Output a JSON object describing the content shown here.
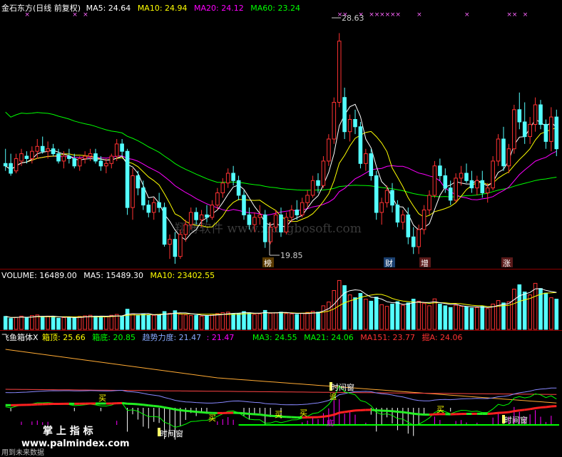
{
  "colors": {
    "bg": "#000000",
    "up": "#ff3232",
    "down": "#54ffff",
    "ma5": "#ffffff",
    "ma10": "#ffff00",
    "ma20": "#ff00ff",
    "ma60": "#00ff00",
    "sep": "#8b0000",
    "label": "#ffffff"
  },
  "header": {
    "title": "金石东方(日线 前复权)",
    "ma5": "MA5: 24.64",
    "ma10": "MA10: 24.94",
    "ma20": "MA20: 24.12",
    "ma60": "MA60: 23.24"
  },
  "price_panel": {
    "high_label": "28.63",
    "low_label": "19.85",
    "markers": [
      "榜",
      "财",
      "增",
      "涨"
    ]
  },
  "volume_panel": {
    "label": "VOLUME: 16489.00",
    "ma5": "MA5: 15489.30",
    "ma10": "MA10: 23402.55"
  },
  "indicator_panel": {
    "name": "飞鱼箱体X",
    "top": "箱顶: 25.66",
    "bottom": "箱底: 20.85",
    "trend": "趋势力度: 21.47",
    "trend2": ": 21.47",
    "ma3": "MA3: 24.55",
    "ma21": "MA21: 24.06",
    "ma151": "MA151: 23.77",
    "jue": "掘A: 24.06",
    "signals": [
      "买",
      "买",
      "买",
      "买",
      "买",
      "时间窗",
      "时间窗",
      "时间窗",
      "追",
      "底"
    ]
  },
  "watermark": {
    "site": "翔博软件 www.xiangbosoft.com",
    "brand": "掌 上 指 标",
    "url": "www.palmindex.com",
    "footer": "用到未来数据"
  },
  "chart_data": {
    "type": "candlestick",
    "title": "金石东方(日线 前复权)",
    "price_range": [
      19.2,
      29.4
    ],
    "annotations": {
      "high": 28.63,
      "low": 19.85
    },
    "ma_last": {
      "MA5": 24.64,
      "MA10": 24.94,
      "MA20": 24.12,
      "MA60": 23.24
    },
    "volume_last": {
      "VOLUME": 16489.0,
      "MA5": 15489.3,
      "MA10": 23402.55
    },
    "candles": [
      [
        23.3,
        23.9,
        23.0,
        23.2
      ],
      [
        23.3,
        23.7,
        22.8,
        22.9
      ],
      [
        23.0,
        23.7,
        22.9,
        23.5
      ],
      [
        23.4,
        23.9,
        23.2,
        23.7
      ],
      [
        23.6,
        23.8,
        23.3,
        23.5
      ],
      [
        23.5,
        24.0,
        23.3,
        23.8
      ],
      [
        23.8,
        24.3,
        23.5,
        24.0
      ],
      [
        24.0,
        24.4,
        23.7,
        23.8
      ],
      [
        23.8,
        24.2,
        23.5,
        23.9
      ],
      [
        23.9,
        24.1,
        23.6,
        23.7
      ],
      [
        23.7,
        23.9,
        23.3,
        23.4
      ],
      [
        23.4,
        23.8,
        23.1,
        23.6
      ],
      [
        23.6,
        23.9,
        23.3,
        23.5
      ],
      [
        23.5,
        23.7,
        23.1,
        23.2
      ],
      [
        23.2,
        23.6,
        23.0,
        23.5
      ],
      [
        23.5,
        23.8,
        23.3,
        23.6
      ],
      [
        23.6,
        23.9,
        23.4,
        23.7
      ],
      [
        23.7,
        23.9,
        23.3,
        23.4
      ],
      [
        23.4,
        23.6,
        23.0,
        23.2
      ],
      [
        23.2,
        23.5,
        22.9,
        23.3
      ],
      [
        23.3,
        23.7,
        23.1,
        23.6
      ],
      [
        23.6,
        24.3,
        23.4,
        24.1
      ],
      [
        24.1,
        24.3,
        23.6,
        23.8
      ],
      [
        23.8,
        23.9,
        21.2,
        21.5
      ],
      [
        21.5,
        23.1,
        21.0,
        22.8
      ],
      [
        22.8,
        23.0,
        22.0,
        22.3
      ],
      [
        22.3,
        22.6,
        21.4,
        21.6
      ],
      [
        21.6,
        21.8,
        21.1,
        21.3
      ],
      [
        21.3,
        21.9,
        21.0,
        21.7
      ],
      [
        21.7,
        22.1,
        21.3,
        21.5
      ],
      [
        21.5,
        21.7,
        19.9,
        20.0
      ],
      [
        20.0,
        20.4,
        19.4,
        20.2
      ],
      [
        20.2,
        20.5,
        19.2,
        19.5
      ],
      [
        19.5,
        20.6,
        19.4,
        20.4
      ],
      [
        20.4,
        21.0,
        20.1,
        20.8
      ],
      [
        20.8,
        21.5,
        20.6,
        21.3
      ],
      [
        21.3,
        21.5,
        20.8,
        21.0
      ],
      [
        21.0,
        21.4,
        20.7,
        21.2
      ],
      [
        21.2,
        21.6,
        20.9,
        21.1
      ],
      [
        21.1,
        21.8,
        21.0,
        21.6
      ],
      [
        21.6,
        22.3,
        21.4,
        22.1
      ],
      [
        22.1,
        22.7,
        21.9,
        22.5
      ],
      [
        22.5,
        23.1,
        22.3,
        22.9
      ],
      [
        22.9,
        23.2,
        22.4,
        22.6
      ],
      [
        22.6,
        22.8,
        21.8,
        22.0
      ],
      [
        22.0,
        22.2,
        21.0,
        21.2
      ],
      [
        21.2,
        21.5,
        20.6,
        20.8
      ],
      [
        20.8,
        21.3,
        20.5,
        21.1
      ],
      [
        21.1,
        21.6,
        20.8,
        21.2
      ],
      [
        21.2,
        21.4,
        19.85,
        20.1
      ],
      [
        20.1,
        20.9,
        20.0,
        20.7
      ],
      [
        20.7,
        21.4,
        20.5,
        21.2
      ],
      [
        21.2,
        21.5,
        20.3,
        20.5
      ],
      [
        20.5,
        21.3,
        20.4,
        21.1
      ],
      [
        21.1,
        21.6,
        20.9,
        21.4
      ],
      [
        21.4,
        21.8,
        21.0,
        21.2
      ],
      [
        21.2,
        21.9,
        21.1,
        21.7
      ],
      [
        21.7,
        22.2,
        21.5,
        22.0
      ],
      [
        22.0,
        22.8,
        21.9,
        22.6
      ],
      [
        22.6,
        22.9,
        22.1,
        22.4
      ],
      [
        22.4,
        23.6,
        22.3,
        23.4
      ],
      [
        23.4,
        24.5,
        23.2,
        24.3
      ],
      [
        24.3,
        26.0,
        24.1,
        25.8
      ],
      [
        25.8,
        28.63,
        25.6,
        28.3
      ],
      [
        26.0,
        26.4,
        24.3,
        24.6
      ],
      [
        24.6,
        25.3,
        24.2,
        25.1
      ],
      [
        25.1,
        25.5,
        24.5,
        24.8
      ],
      [
        24.8,
        25.0,
        23.1,
        23.3
      ],
      [
        23.3,
        23.9,
        23.0,
        23.7
      ],
      [
        23.7,
        23.9,
        22.6,
        22.8
      ],
      [
        22.8,
        23.0,
        21.0,
        21.3
      ],
      [
        21.3,
        21.9,
        20.8,
        21.7
      ],
      [
        21.7,
        22.4,
        21.5,
        22.2
      ],
      [
        22.2,
        22.5,
        21.3,
        21.6
      ],
      [
        21.6,
        21.8,
        20.7,
        20.9
      ],
      [
        20.9,
        21.4,
        20.6,
        21.2
      ],
      [
        21.2,
        21.5,
        20.0,
        20.3
      ],
      [
        20.3,
        20.7,
        19.6,
        19.9
      ],
      [
        19.9,
        20.8,
        19.6,
        20.6
      ],
      [
        20.6,
        21.6,
        20.4,
        21.4
      ],
      [
        21.4,
        22.2,
        21.2,
        22.0
      ],
      [
        22.0,
        23.4,
        21.9,
        23.2
      ],
      [
        23.2,
        23.5,
        22.6,
        22.8
      ],
      [
        22.8,
        23.1,
        22.1,
        22.3
      ],
      [
        22.3,
        22.6,
        21.6,
        21.8
      ],
      [
        21.8,
        22.9,
        21.7,
        22.7
      ],
      [
        22.7,
        23.2,
        22.4,
        22.9
      ],
      [
        22.9,
        23.3,
        22.5,
        22.6
      ],
      [
        22.6,
        23.0,
        22.1,
        22.3
      ],
      [
        22.3,
        22.8,
        22.0,
        22.6
      ],
      [
        22.6,
        23.0,
        21.9,
        22.1
      ],
      [
        22.1,
        22.5,
        21.7,
        22.3
      ],
      [
        22.3,
        23.6,
        22.2,
        23.4
      ],
      [
        23.4,
        24.5,
        23.2,
        24.3
      ],
      [
        24.3,
        24.8,
        23.0,
        23.2
      ],
      [
        23.2,
        24.1,
        22.9,
        23.9
      ],
      [
        23.9,
        25.7,
        23.7,
        25.5
      ],
      [
        25.5,
        26.2,
        24.7,
        25.0
      ],
      [
        25.0,
        25.8,
        24.1,
        24.4
      ],
      [
        24.4,
        25.2,
        24.1,
        24.9
      ],
      [
        24.9,
        26.0,
        24.6,
        25.7
      ],
      [
        25.7,
        25.9,
        24.7,
        24.9
      ],
      [
        24.9,
        25.1,
        23.9,
        24.2
      ],
      [
        24.2,
        25.6,
        23.8,
        25.2
      ],
      [
        25.2,
        25.5,
        23.6,
        23.9
      ]
    ],
    "volume": [
      4.5,
      3.8,
      4.2,
      4.6,
      4.0,
      4.8,
      5.0,
      4.4,
      4.6,
      4.2,
      3.9,
      4.1,
      4.3,
      4.0,
      4.5,
      4.7,
      4.9,
      4.6,
      4.3,
      4.4,
      4.9,
      5.2,
      4.7,
      7.0,
      5.4,
      4.8,
      5.3,
      5.0,
      4.9,
      5.1,
      6.2,
      5.6,
      6.5,
      5.3,
      5.0,
      4.8,
      4.9,
      4.6,
      4.8,
      5.2,
      5.5,
      5.8,
      6.0,
      5.4,
      5.6,
      6.2,
      5.8,
      5.2,
      5.4,
      6.6,
      5.6,
      5.8,
      6.0,
      5.5,
      5.4,
      5.2,
      5.6,
      5.9,
      6.3,
      6.0,
      8.2,
      9.5,
      13.5,
      17.0,
      15.2,
      12.0,
      11.0,
      12.5,
      10.5,
      9.8,
      11.2,
      8.6,
      8.0,
      8.8,
      9.6,
      8.4,
      9.2,
      10.5,
      9.8,
      9.0,
      8.2,
      10.6,
      8.8,
      8.2,
      7.6,
      8.4,
      8.0,
      7.8,
      7.4,
      7.6,
      8.0,
      7.2,
      8.8,
      10.0,
      9.2,
      9.6,
      14.0,
      15.5,
      13.0,
      12.0,
      16.0,
      14.2,
      12.6,
      11.0,
      10.5
    ]
  }
}
